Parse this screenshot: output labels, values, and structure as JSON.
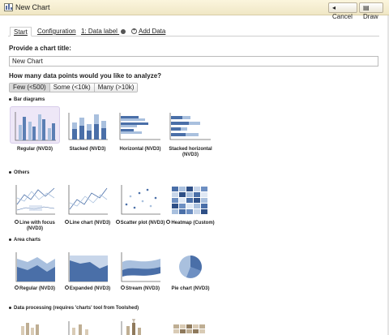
{
  "window": {
    "title": "New Chart",
    "cancel_label": "Cancel",
    "draw_label": "Draw"
  },
  "tabs": [
    {
      "label": "Start",
      "active": true
    },
    {
      "label": "Configuration",
      "active": false
    },
    {
      "label": "1: Data label",
      "active": false
    },
    {
      "label": "Add Data",
      "active": false
    }
  ],
  "form": {
    "title_prompt": "Provide a chart title:",
    "title_value": "New Chart",
    "points_prompt": "How many data points would you like to analyze?",
    "point_options": [
      {
        "label": "Few (<500)",
        "active": true
      },
      {
        "label": "Some (<10k)",
        "active": false
      },
      {
        "label": "Many (>10k)",
        "active": false
      }
    ]
  },
  "sections": [
    {
      "label": "Bar diagrams",
      "items": [
        {
          "label": "Regular (NVD3)",
          "selected": true
        },
        {
          "label": "Stacked (NVD3)"
        },
        {
          "label": "Horizontal (NVD3)"
        },
        {
          "label": "Stacked horizontal (NVD3)"
        }
      ]
    },
    {
      "label": "Others",
      "items": [
        {
          "label": "Line with focus (NVD3)"
        },
        {
          "label": "Line chart (NVD3)"
        },
        {
          "label": "Scatter plot (NVD3)"
        },
        {
          "label": "Heatmap (Custom)"
        }
      ]
    },
    {
      "label": "Area charts",
      "items": [
        {
          "label": "Regular (NVD3)"
        },
        {
          "label": "Expanded (NVD3)"
        },
        {
          "label": "Stream (NVD3)"
        },
        {
          "label": "Pie chart (NVD3)"
        }
      ]
    },
    {
      "label": "Data processing (requires 'charts' tool from Toolshed)",
      "items": []
    }
  ],
  "colors": {
    "accent_blue": "#4a6fa8",
    "light_blue": "#a9c0de",
    "tile_selected": "#eee7f7",
    "titlebar": "#f5edcf"
  }
}
